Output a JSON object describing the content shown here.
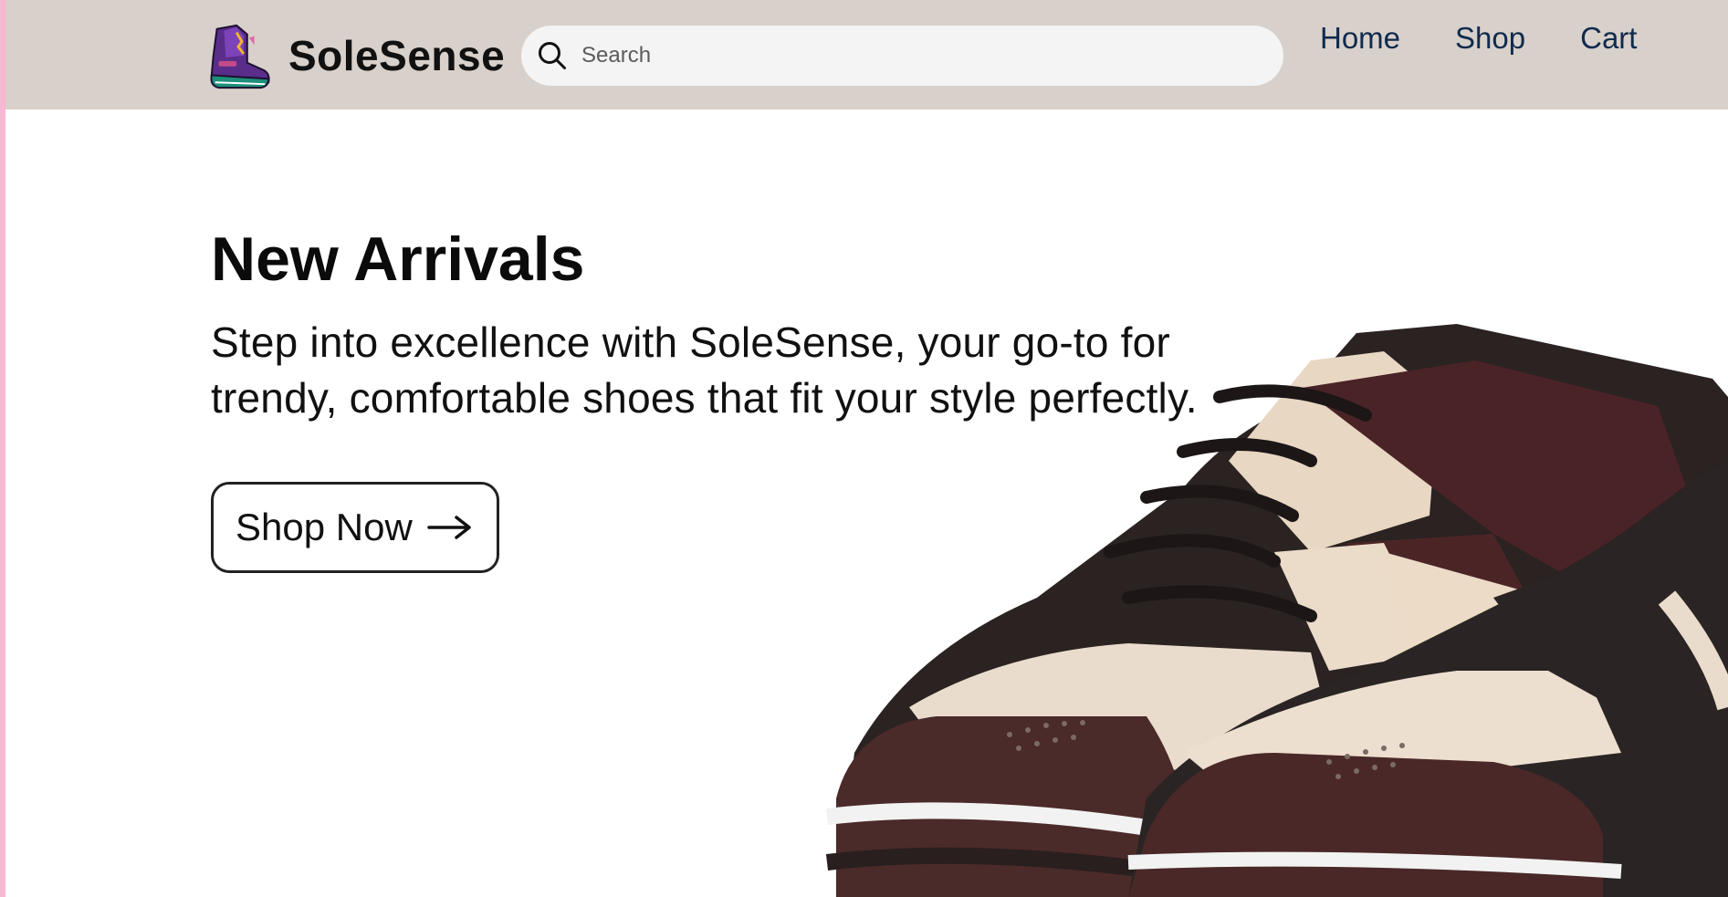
{
  "brand": {
    "name": "SoleSense",
    "logo_icon": "sneaker-logo-icon"
  },
  "search": {
    "placeholder": "Search",
    "value": "",
    "icon": "search-icon"
  },
  "nav": {
    "items": [
      {
        "label": "Home"
      },
      {
        "label": "Shop"
      },
      {
        "label": "Cart"
      }
    ]
  },
  "hero": {
    "title": "New Arrivals",
    "description": "Step into excellence with SoleSense, your go-to for trendy, comfortable shoes that fit your style perfectly.",
    "cta_label": "Shop Now",
    "cta_icon": "arrow-right-icon",
    "image": "sneakers-image"
  },
  "colors": {
    "header_bg": "#d8d0ca",
    "page_bg": "#ffffff",
    "nav_text": "#0f2a4d",
    "accent_edge": "#f7b8d2",
    "shoe_leather": "#4b2a2a",
    "shoe_cream": "#eadccc"
  }
}
